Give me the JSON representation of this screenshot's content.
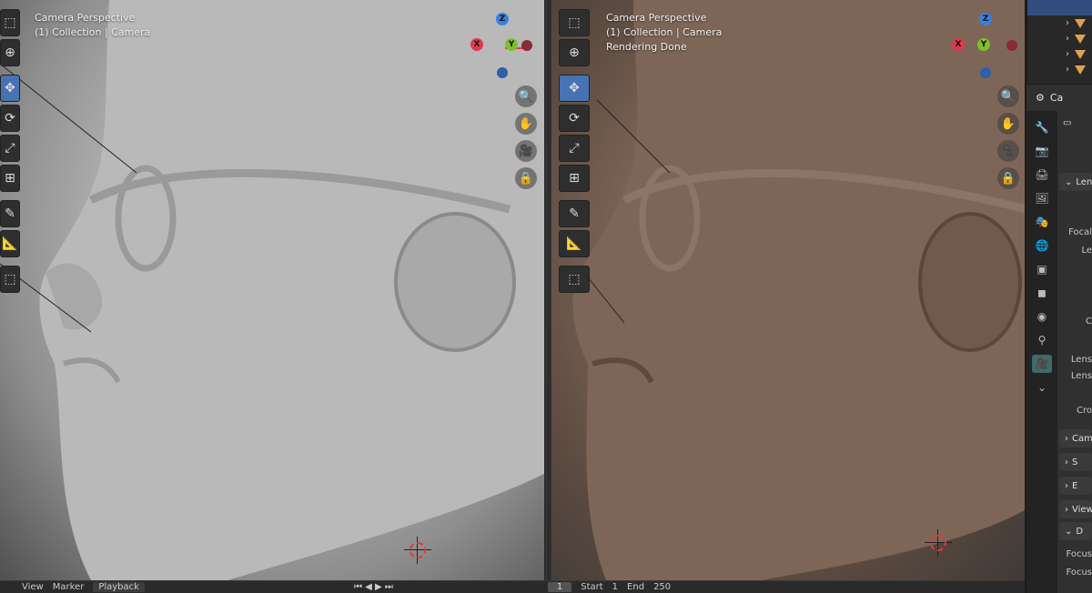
{
  "left_viewport": {
    "overlay_lines": [
      "Camera Perspective",
      "(1) Collection | Camera"
    ],
    "tools": [
      "select-box-icon",
      "cursor-icon",
      "move-icon",
      "rotate-icon",
      "scale-icon",
      "transform-icon",
      "annotate-icon",
      "measure-icon",
      "add-cube-icon"
    ],
    "nav_buttons": [
      "zoom-icon",
      "pan-hand-icon",
      "camera-view-icon",
      "lock-icon"
    ],
    "gizmo": {
      "x": "X",
      "y": "Y",
      "z": "Z"
    }
  },
  "right_viewport": {
    "overlay_lines": [
      "Camera Perspective",
      "(1) Collection | Camera",
      "Rendering Done"
    ],
    "tools": [
      "select-box-icon",
      "cursor-icon",
      "move-icon",
      "rotate-icon",
      "scale-icon",
      "transform-icon",
      "annotate-icon",
      "measure-icon",
      "add-cube-icon"
    ],
    "nav_buttons": [
      "zoom-icon",
      "pan-hand-icon",
      "camera-view-icon",
      "lock-icon"
    ],
    "gizmo": {
      "x": "X",
      "y": "Y",
      "z": "Z"
    }
  },
  "timeline_bar": {
    "view": "View",
    "marker": "Marker",
    "playback": "Playback",
    "current_frame": "1",
    "start_label": "Start",
    "start_value": "1",
    "end_label": "End",
    "end_value": "250"
  },
  "outliner": {
    "rows": [
      "",
      "",
      "",
      "",
      ""
    ]
  },
  "properties": {
    "header_label": "Ca",
    "sections": [
      "Len",
      "Cam",
      "S",
      "E",
      "View",
      "D"
    ],
    "labels": [
      "Focal",
      "Le",
      "C",
      "Lens",
      "Lens",
      "Cro",
      "Focus",
      "Focus"
    ]
  },
  "colors": {
    "accent_active_tool": "#4772b3",
    "axis_x": "#e0384d",
    "axis_y": "#7fbf2e",
    "axis_z": "#3a7fe0"
  }
}
